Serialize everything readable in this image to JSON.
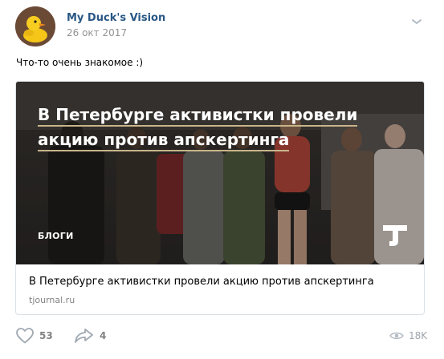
{
  "post": {
    "author": "My Duck's Vision",
    "date": "26 окт 2017",
    "text": "Что-то очень знакомое :)"
  },
  "card": {
    "image_headline": "В Петербурге активистки провели акцию против апскертинга",
    "category": "БЛОГИ",
    "title": "В Петербурге активистки провели акцию против апскертинга",
    "domain": "tjournal.ru"
  },
  "actions": {
    "likes": "53",
    "shares": "4",
    "views": "18K"
  },
  "icons": {
    "avatar": "rubber-duck-avatar",
    "more": "chevron-down-icon",
    "like": "heart-icon",
    "share": "share-arrow-icon",
    "views": "eye-icon",
    "source_logo": "tj-logo"
  },
  "colors": {
    "author": "#2a5885",
    "muted": "#939393",
    "action": "#828282"
  }
}
